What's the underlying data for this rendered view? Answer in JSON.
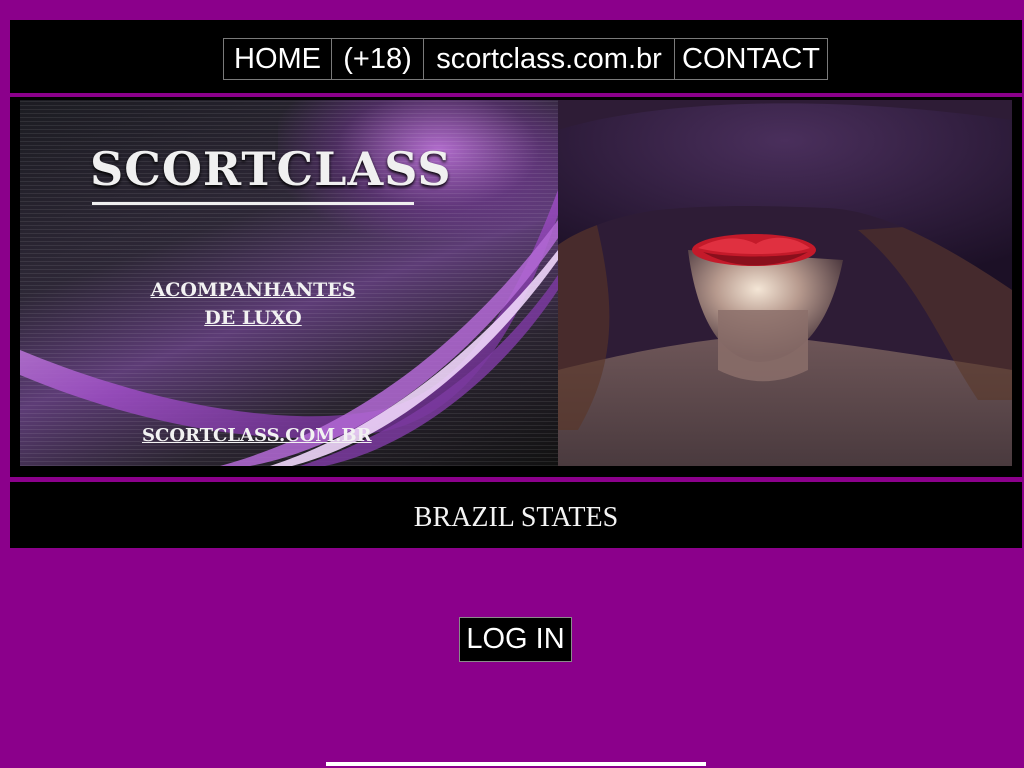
{
  "nav": {
    "home": "HOME",
    "age": "(+18)",
    "domain": "scortclass.com.br",
    "contact": "CONTACT"
  },
  "banner": {
    "brand_title": "SCORTCLASS",
    "brand_subtitle_line1": "ACOMPANHANTES",
    "brand_subtitle_line2": "DE LUXO",
    "brand_domain": "SCORTCLASS.COM.BR"
  },
  "states": {
    "title": "BRAZIL STATES"
  },
  "login": {
    "label": "LOG IN"
  },
  "colors": {
    "page_background": "#8b008b",
    "bar_background": "#000000",
    "text": "#ffffff",
    "lips": "#c41a2a"
  }
}
